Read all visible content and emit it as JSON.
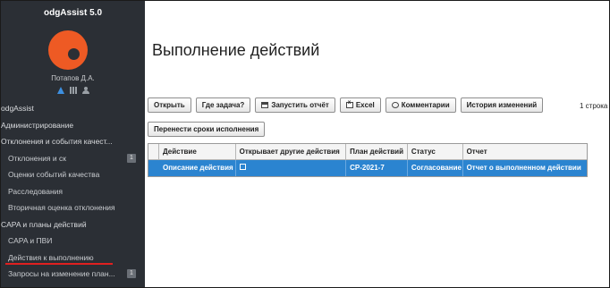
{
  "sidebar": {
    "app_title": "odgAssist 5.0",
    "user_name": "Потапов Д.А.",
    "user_icons": [
      "warning-icon",
      "grid-icon",
      "user-icon"
    ],
    "items": [
      {
        "label": "odgAssist",
        "type": "section"
      },
      {
        "label": "Администрирование",
        "type": "section"
      },
      {
        "label": "Отклонения и события качест...",
        "type": "section"
      },
      {
        "label": "Отклонения и ск",
        "type": "sub",
        "badge": "1"
      },
      {
        "label": "Оценки событий качества",
        "type": "sub"
      },
      {
        "label": "Расследования",
        "type": "sub"
      },
      {
        "label": "Вторичная оценка отклонения",
        "type": "sub"
      },
      {
        "label": "CAPA и планы действий",
        "type": "section"
      },
      {
        "label": "CAPA и ПВИ",
        "type": "sub"
      },
      {
        "label": "Действия к выполнению",
        "type": "sub",
        "active": true
      },
      {
        "label": "Запросы на изменение план...",
        "type": "sub",
        "badge": "1"
      }
    ]
  },
  "main": {
    "title": "Выполнение действий",
    "toolbar": {
      "open": "Открыть",
      "where_task": "Где задача?",
      "run_report": "Запустить отчёт",
      "excel": "Excel",
      "comments": "Комментарии",
      "history": "История изменений",
      "postpone": "Перенести сроки исполнения"
    },
    "row_count": "1 строка",
    "grid": {
      "columns": [
        "",
        "Действие",
        "Открывает другие действия",
        "План действий",
        "Статус",
        "Отчет"
      ],
      "rows": [
        {
          "action": "Описание действия",
          "opens_other": "",
          "plan": "CP-2021-7",
          "status": "Согласование",
          "report": "Отчет о выполненном действии",
          "selected": true
        }
      ]
    }
  },
  "colors": {
    "sidebar_bg": "#2b2f35",
    "avatar": "#ee5a24",
    "selection": "#2b84d0",
    "active_underline": "#e02020"
  }
}
